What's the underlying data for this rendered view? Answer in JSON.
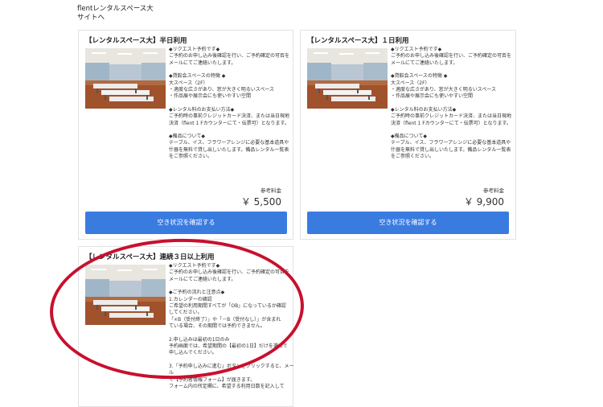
{
  "header": {
    "line1": "flentレンタルスペース大",
    "line2": "サイトへ"
  },
  "cards": [
    {
      "title": "【レンタルスペース大】半日利用",
      "desc": [
        "◆リクエスト予約です◆\nご予約のお申し込み後確認を行い、ご予約確定の可否を\nメールにてご連絡いたします。",
        "◆貸館会スペースの特徴 ◆\n大スペース（2F）\n・適度な広さがあり、窓が大きく明るいスペース\n・作品展や展示会にも使いやすい空間",
        "◆レンタル料のお支払い方法◆\nご予約時の事前クレジットカード決済、または当日現地\n決済（flent 1 Fカウンターにて・伝票可）となります。",
        "◆備品について◆\nテーブル、イス、フラワーアレンジに必要な基本道具や\n什器を無料で貸し出しいたします。備品レンタル一覧表\nをご参照ください。"
      ],
      "price_label": "参考料金",
      "price": "￥ 5,500",
      "button": "空き状況を確認する"
    },
    {
      "title": "【レンタルスペース大】１日利用",
      "desc": [
        "◆リクエスト予約です◆\nご予約のお申し込み後確認を行い、ご予約確定の可否を\nメールにてご連絡いたします。",
        "◆貸館会スペースの特徴 ◆\n大スペース（2F）\n・適度な広さがあり、窓が大きく明るいスペース\n・作品展や展示会にも使いやすい空間",
        "◆レンタル料のお支払い方法◆\nご予約時の事前クレジットカード決済、または当日現地\n決済（flent 1 Fカウンターにて・伝票可）となります。",
        "◆備品について◆\nテーブル、イス、フラワーアレンジに必要な基本道具や\n什器を無料で貸し出しいたします。備品レンタル一覧表\nをご参照ください。"
      ],
      "price_label": "参考料金",
      "price": "￥ 9,900",
      "button": "空き状況を確認する"
    },
    {
      "title": "【レンタルスペース大】連続３日以上利用",
      "desc": [
        "◆リクエスト予約です◆\nご予約のお申し込み後確認を行い、ご予約確定の可否を\nメールにてご連絡いたします。",
        "◆ご予約の流れと注意点◆\n1.カレンダーの確認\nご希望の利用期間すべてが「OB」になっているか確認\nしてください。\n「×B（受付終了）」や「－B（受付なし）」が含まれ\nている場合、その期間では予約できません。",
        "2.申し込みは最初の1日のみ\n予約画面では、希望期間の【最初の1日】だけを選んで\n申し込んでください。",
        "3.「予約申し込みに進む」ボタンをクリックすると、メール\nで【予約者情報フォーム】が届きます。\nフォーム内の所定欄に、希望する利用日数を記入して"
      ]
    }
  ],
  "colors": {
    "button": "#3a7be0",
    "highlight": "#c8102e"
  }
}
